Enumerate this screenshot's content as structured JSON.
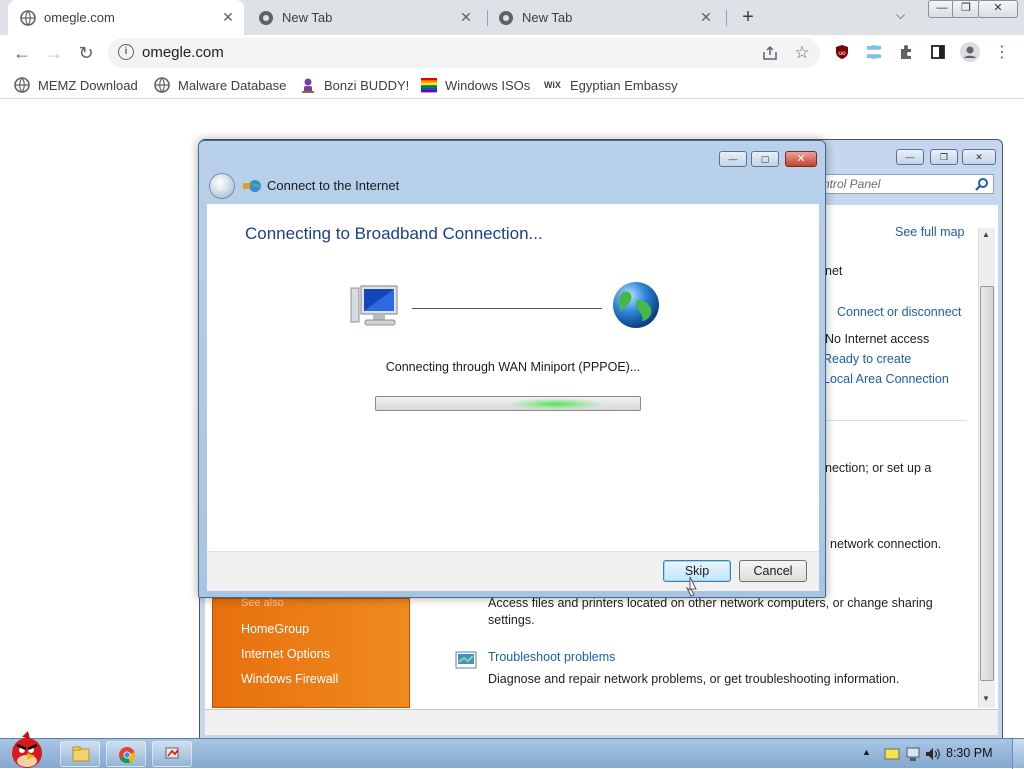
{
  "browser": {
    "tabs": [
      {
        "title": "omegle.com",
        "active": true
      },
      {
        "title": "New Tab",
        "active": false
      },
      {
        "title": "New Tab",
        "active": false
      }
    ],
    "address": "omegle.com",
    "bookmarks": [
      {
        "label": "MEMZ Download",
        "icon": "globe-icon"
      },
      {
        "label": "Malware Database",
        "icon": "globe-icon"
      },
      {
        "label": "Bonzi BUDDY!",
        "icon": "bonzi-icon"
      },
      {
        "label": "Windows ISOs",
        "icon": "rainbow-flag-icon"
      },
      {
        "label": "Egyptian Embassy",
        "icon": "wix-icon"
      }
    ],
    "wix_text": "WiX"
  },
  "control_panel": {
    "search_placeholder": "ntrol Panel",
    "see_full_map": "See full map",
    "net_text": "net",
    "connect_link": "Connect or disconnect",
    "access_text": "No Internet access",
    "ready_link": "Ready to create",
    "lan_link": "Local Area Connection",
    "setup_text": "nection; or set up a",
    "network_text": "network connection.",
    "access_files_text": "Access files and printers located on other network computers, or change sharing",
    "settings_text": "settings.",
    "troubleshoot_link": "Troubleshoot problems",
    "diagnose_text": "Diagnose and repair network problems, or get troubleshooting information.",
    "sidebar": {
      "header": "See also",
      "items": [
        "HomeGroup",
        "Internet Options",
        "Windows Firewall"
      ]
    }
  },
  "dialog": {
    "title": "Connect to the Internet",
    "heading": "Connecting to Broadband Connection...",
    "status": "Connecting through WAN Miniport (PPPOE)...",
    "skip_label": "Skip",
    "cancel_label": "Cancel"
  },
  "taskbar": {
    "time": "8:30 PM"
  }
}
